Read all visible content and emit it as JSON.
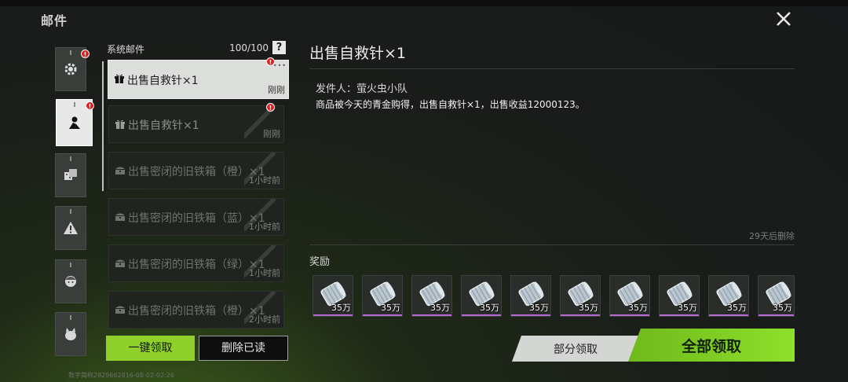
{
  "page": {
    "title": "邮件"
  },
  "categories": [
    {
      "icon": "gear-icon",
      "badge": "!"
    },
    {
      "icon": "character-card-icon",
      "badge": "!"
    },
    {
      "icon": "dice-icon",
      "badge": ""
    },
    {
      "icon": "warning-icon",
      "badge": ""
    },
    {
      "icon": "character-face-icon",
      "badge": ""
    },
    {
      "icon": "creature-icon",
      "badge": ""
    }
  ],
  "mail_list": {
    "header": "系统邮件",
    "count": "100/100",
    "help": "?",
    "items": [
      {
        "icon": "gift-icon",
        "subject": "出售自救针×1",
        "time": "刚刚",
        "badge": "!"
      },
      {
        "icon": "gift-icon",
        "subject": "出售自救针×1",
        "time": "刚刚",
        "badge": "!"
      },
      {
        "icon": "chest-icon",
        "subject": "出售密闭的旧铁箱（橙）×1",
        "time": "1小时前",
        "badge": ""
      },
      {
        "icon": "chest-icon",
        "subject": "出售密闭的旧铁箱（蓝）×1",
        "time": "1小时前",
        "badge": ""
      },
      {
        "icon": "chest-icon",
        "subject": "出售密闭的旧铁箱（绿）×1",
        "time": "1小时前",
        "badge": ""
      },
      {
        "icon": "chest-icon",
        "subject": "出售密闭的旧铁箱（橙）×1",
        "time": "2小时前",
        "badge": ""
      }
    ]
  },
  "buttons": {
    "claim_one": "一键领取",
    "delete_read": "删除已读",
    "partial_claim": "部分领取",
    "claim_all": "全部领取"
  },
  "footer": {
    "id_text": "数字简称2829662816-08-02-02:26"
  },
  "detail": {
    "title": "出售自救针×1",
    "sender": "发件人：萤火虫小队",
    "body": "商品被今天的青金购得，出售自救针×1，出售收益12000123。",
    "expire": "29天后删除",
    "reward_label": "奖励",
    "rewards": [
      {
        "amount": "35万"
      },
      {
        "amount": "35万"
      },
      {
        "amount": "35万"
      },
      {
        "amount": "35万"
      },
      {
        "amount": "35万"
      },
      {
        "amount": "35万"
      },
      {
        "amount": "35万"
      },
      {
        "amount": "35万"
      },
      {
        "amount": "35万"
      },
      {
        "amount": "35万"
      }
    ]
  },
  "colors": {
    "accent_green": "#8ee02b",
    "badge_red": "#e01e1e",
    "rarity_purple": "#b46ad0"
  }
}
